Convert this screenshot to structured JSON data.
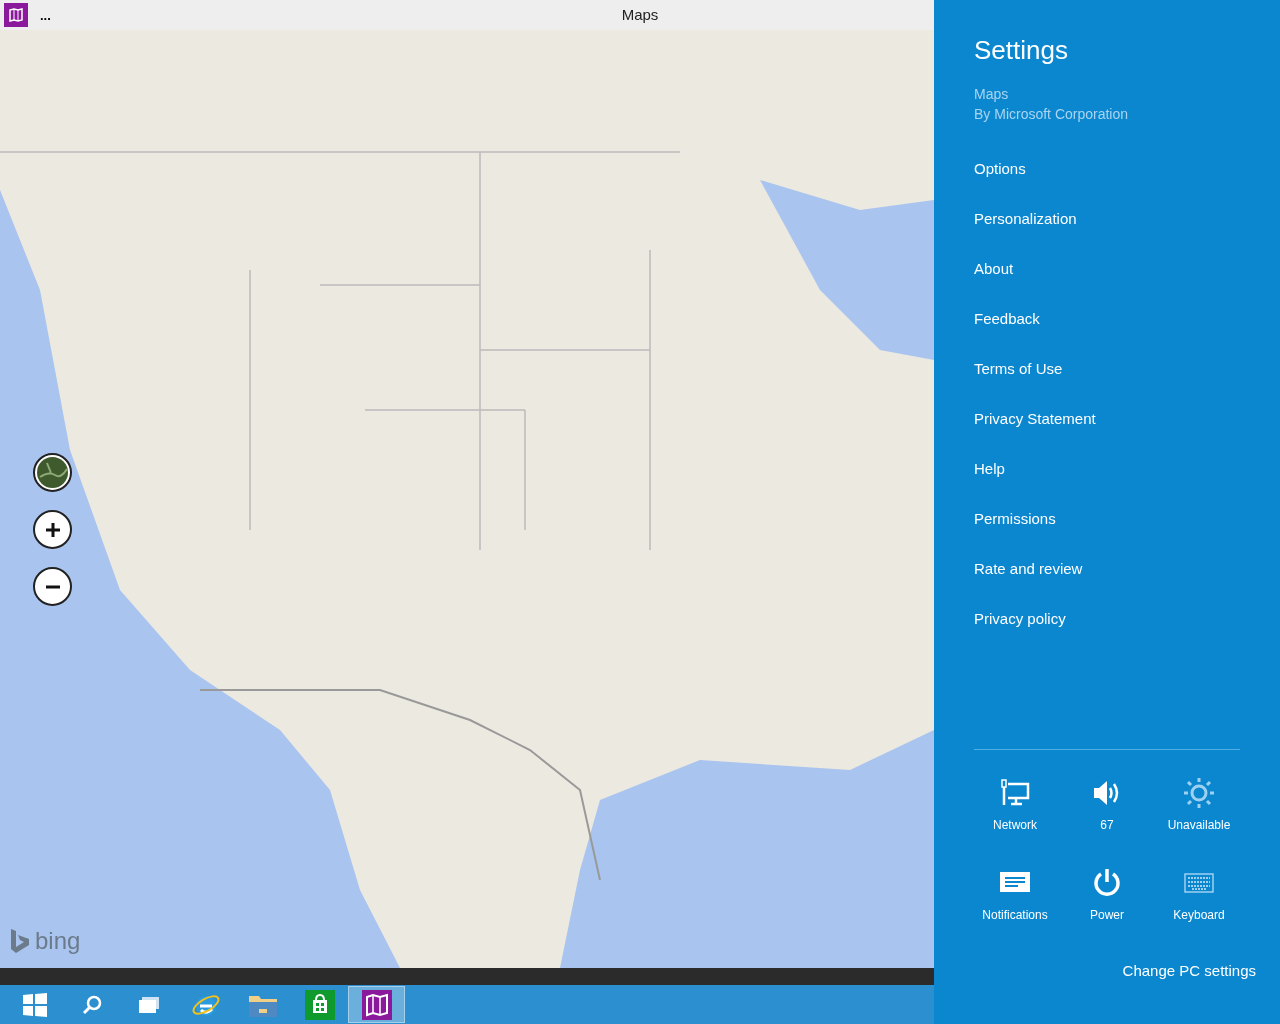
{
  "window": {
    "title": "Maps",
    "menu": "..."
  },
  "map": {
    "brand": "bing"
  },
  "map_controls": [
    {
      "kind": "aerial"
    },
    {
      "kind": "zoom_in"
    },
    {
      "kind": "zoom_out"
    }
  ],
  "taskbar": [
    {
      "kind": "start",
      "selected": false
    },
    {
      "kind": "search",
      "selected": false
    },
    {
      "kind": "task_view",
      "selected": false
    },
    {
      "kind": "browser",
      "selected": false
    },
    {
      "kind": "files",
      "selected": false
    },
    {
      "kind": "store",
      "selected": false
    },
    {
      "kind": "maps",
      "selected": true
    }
  ],
  "settings": {
    "title": "Settings",
    "app_name": "Maps",
    "publisher": "By Microsoft Corporation",
    "items": [
      "Options",
      "Personalization",
      "About",
      "Feedback",
      "Terms of Use",
      "Privacy Statement",
      "Help",
      "Permissions",
      "Rate and review",
      "Privacy policy"
    ],
    "quick": [
      {
        "kind": "network",
        "label": "Network",
        "disabled": false
      },
      {
        "kind": "volume",
        "label": "67",
        "disabled": false
      },
      {
        "kind": "brightness",
        "label": "Unavailable",
        "disabled": true
      },
      {
        "kind": "notifications",
        "label": "Notifications",
        "disabled": false
      },
      {
        "kind": "power",
        "label": "Power",
        "disabled": false
      },
      {
        "kind": "keyboard",
        "label": "Keyboard",
        "disabled": true
      }
    ],
    "change_pc_settings": "Change PC settings"
  }
}
